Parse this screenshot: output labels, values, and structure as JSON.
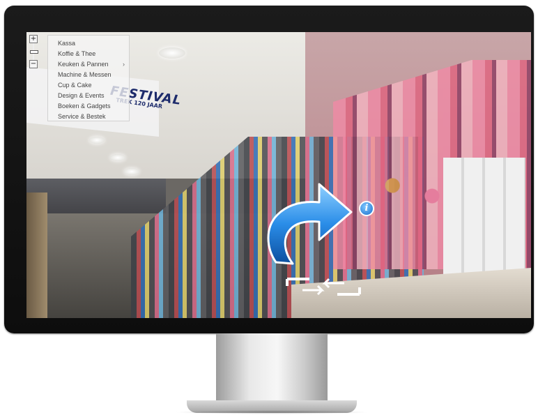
{
  "viewer": {
    "zoom_in_label": "+",
    "zoom_out_label": "−"
  },
  "menu": {
    "items": [
      {
        "label": "Kassa",
        "has_submenu": false
      },
      {
        "label": "Koffie & Thee",
        "has_submenu": false
      },
      {
        "label": "Keuken & Pannen",
        "has_submenu": true
      },
      {
        "label": "Machine & Messen",
        "has_submenu": false
      },
      {
        "label": "Cup & Cake",
        "has_submenu": false
      },
      {
        "label": "Design & Events",
        "has_submenu": false
      },
      {
        "label": "Boeken & Gadgets",
        "has_submenu": false
      },
      {
        "label": "Service & Bestek",
        "has_submenu": false
      }
    ],
    "submenu_icon": "chevron-right-icon"
  },
  "scene": {
    "banner_title": "FESTIVAL",
    "banner_subtitle": "TREK 120 JAAR"
  },
  "hotspots": {
    "navigate_icon": "curved-arrow-icon",
    "info_icon": "info-icon",
    "info_glyph": "i",
    "fullscreen_icon": "expand-arrows-icon"
  },
  "colors": {
    "arrow_blue": "#1f7fe0",
    "info_blue": "#1b6fcc",
    "menu_bg": "#f5f5f5"
  }
}
